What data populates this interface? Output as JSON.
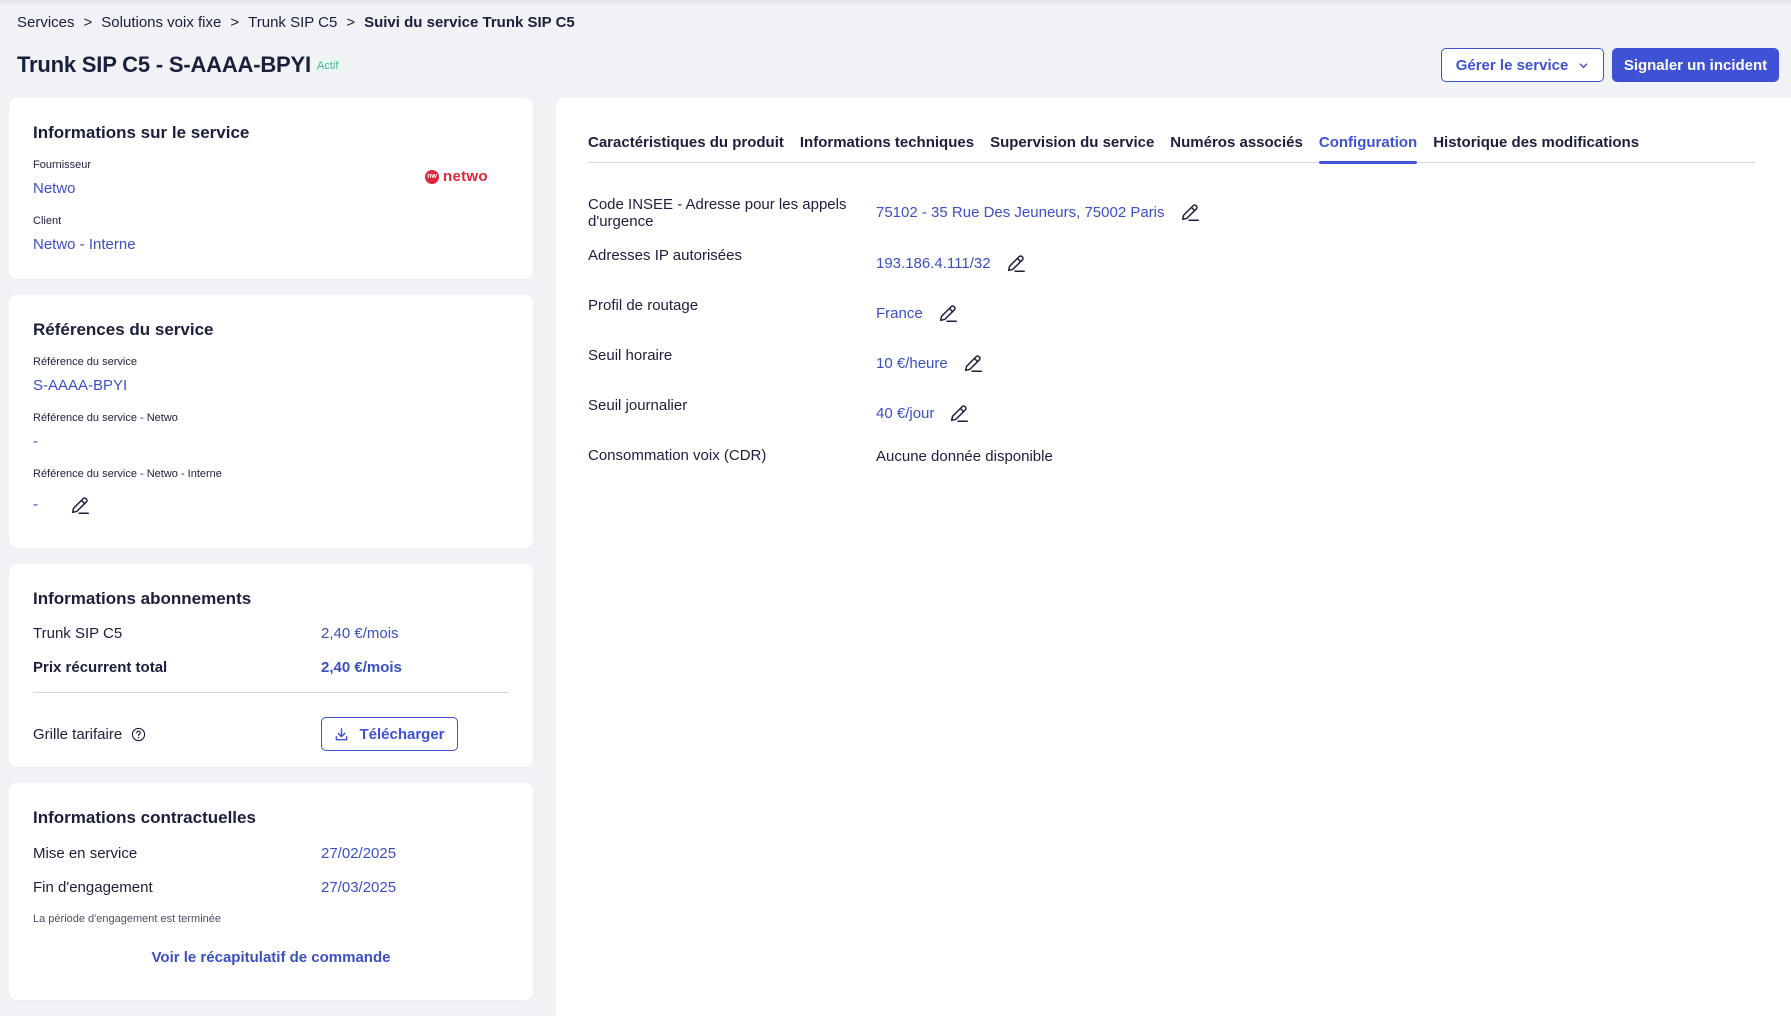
{
  "breadcrumb": {
    "items": [
      "Services",
      "Solutions voix fixe",
      "Trunk SIP C5"
    ],
    "separator": ">",
    "current": "Suivi du service Trunk SIP C5"
  },
  "header": {
    "title": "Trunk SIP C5 - S-AAAA-BPYI",
    "status": "Actif",
    "manage_button": "Gérer le service",
    "incident_button": "Signaler un incident"
  },
  "service_info": {
    "title": "Informations sur le service",
    "provider_label": "Fournisseur",
    "provider_value": "Netwo",
    "client_label": "Client",
    "client_value": "Netwo - Interne",
    "logo_text": "netwo",
    "logo_mark": "nw"
  },
  "references": {
    "title": "Références du service",
    "ref_label": "Référence du service",
    "ref_value": "S-AAAA-BPYI",
    "ref_netwo_label": "Référence du service - Netwo",
    "ref_netwo_value": "-",
    "ref_internal_label": "Référence du service - Netwo - Interne",
    "ref_internal_value": "-"
  },
  "subscriptions": {
    "title": "Informations abonnements",
    "item_label": "Trunk SIP C5",
    "item_price": "2,40 €/mois",
    "total_label": "Prix récurrent total",
    "total_price": "2,40 €/mois",
    "grid_label": "Grille tarifaire",
    "download_button": "Télécharger"
  },
  "contract": {
    "title": "Informations contractuelles",
    "start_label": "Mise en service",
    "start_value": "27/02/2025",
    "end_label": "Fin d'engagement",
    "end_value": "27/03/2025",
    "note": "La période d'engagement est terminée",
    "summary_link": "Voir le récapitulatif de commande"
  },
  "tabs": [
    {
      "label": "Caractéristiques du produit",
      "active": false
    },
    {
      "label": "Informations techniques",
      "active": false
    },
    {
      "label": "Supervision du service",
      "active": false
    },
    {
      "label": "Numéros associés",
      "active": false
    },
    {
      "label": "Configuration",
      "active": true
    },
    {
      "label": "Historique des modifications",
      "active": false
    }
  ],
  "configuration": [
    {
      "label": "Code INSEE - Adresse pour les appels d'urgence",
      "value": "75102 - 35 Rue Des Jeuneurs, 75002 Paris",
      "editable": true
    },
    {
      "label": "Adresses IP autorisées",
      "value": "193.186.4.111/32",
      "editable": true
    },
    {
      "label": "Profil de routage",
      "value": "France",
      "editable": true
    },
    {
      "label": "Seuil horaire",
      "value": "10 €/heure",
      "editable": true
    },
    {
      "label": "Seuil journalier",
      "value": "40 €/jour",
      "editable": true
    },
    {
      "label": "Consommation voix (CDR)",
      "value": "Aucune donnée disponible",
      "editable": false
    }
  ],
  "colors": {
    "accent": "#3f51d4",
    "link": "#3b4fc4",
    "text": "#1b1f3b",
    "background": "#f1f2f6",
    "status_green": "#3fb89a",
    "brand_red": "#e0273a"
  },
  "icons": {
    "edit": "pencil-icon",
    "chevron": "chevron-down-icon",
    "download": "download-icon",
    "help": "question-circle-icon"
  }
}
